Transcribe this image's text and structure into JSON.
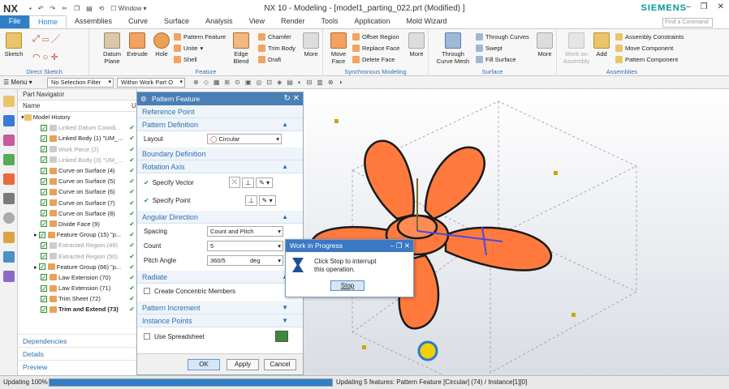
{
  "app": {
    "logo": "NX",
    "title": "NX 10 - Modeling - [model1_parting_022.prt  (Modified)  ]",
    "brand": "SIEMENS",
    "window_menu": "Window"
  },
  "tabs": [
    "File",
    "Home",
    "Assemblies",
    "Curve",
    "Surface",
    "Analysis",
    "View",
    "Render",
    "Tools",
    "Application",
    "Mold Wizard"
  ],
  "search": {
    "placeholder": "Find a Command"
  },
  "ribbon": {
    "direct_sketch": {
      "label": "Direct Sketch",
      "sketch": "Sketch"
    },
    "feature": {
      "label": "Feature",
      "datum": "Datum Plane",
      "extrude": "Extrude",
      "hole": "Hole",
      "pattern_feature": "Pattern Feature",
      "unite": "Unite",
      "shell": "Shell",
      "edge_blend": "Edge Blend",
      "chamfer": "Chamfer",
      "trim_body": "Trim Body",
      "draft": "Draft",
      "more": "More"
    },
    "sync": {
      "label": "Synchronous Modeling",
      "move_face": "Move Face",
      "offset_region": "Offset Region",
      "replace_face": "Replace Face",
      "delete_face": "Delete Face",
      "more": "More"
    },
    "surface": {
      "label": "Surface",
      "through_curve_mesh": "Through Curve Mesh",
      "through_curves": "Through Curves",
      "swept": "Swept",
      "fill_surface": "Fill Surface",
      "more": "More"
    },
    "assemblies": {
      "label": "Assemblies",
      "work_on_assembly": "Work on Assembly",
      "add": "Add",
      "assembly_constraints": "Assembly Constraints",
      "move_component": "Move Component",
      "pattern_component": "Pattern Component"
    }
  },
  "toolbar": {
    "menu": "Menu",
    "filter": "No Selection Filter",
    "scope": "Within Work Part O"
  },
  "navigator": {
    "title": "Part Navigator",
    "col_name": "Name",
    "col_u": "U",
    "root": "Model History",
    "items": [
      {
        "label": "Linked Datum Coordi...",
        "style": "gray"
      },
      {
        "label": "Linked Body (1) \"UM_...",
        "style": "normal"
      },
      {
        "label": "Work Piece (2)",
        "style": "gray"
      },
      {
        "label": "Linked Body (3) \"UM_...",
        "style": "gray"
      },
      {
        "label": "Curve on Surface (4)",
        "style": "normal"
      },
      {
        "label": "Curve on Surface (5)",
        "style": "normal"
      },
      {
        "label": "Curve on Surface (6)",
        "style": "normal"
      },
      {
        "label": "Curve on Surface (7)",
        "style": "normal"
      },
      {
        "label": "Curve on Surface (8)",
        "style": "normal"
      },
      {
        "label": "Divide Face (9)",
        "style": "normal"
      },
      {
        "label": "Feature Group (15) \"p...",
        "style": "normal"
      },
      {
        "label": "Extracted Region (49)",
        "style": "gray"
      },
      {
        "label": "Extracted Region (50)",
        "style": "gray"
      },
      {
        "label": "Feature Group (66) \"p...",
        "style": "normal"
      },
      {
        "label": "Law Extension (70)",
        "style": "normal"
      },
      {
        "label": "Law Extension (71)",
        "style": "normal"
      },
      {
        "label": "Trim Sheet (72)",
        "style": "normal"
      },
      {
        "label": "Trim and Extend (73)",
        "style": "bold"
      }
    ],
    "links": [
      "Dependencies",
      "Details",
      "Preview"
    ]
  },
  "dialog": {
    "title": "Pattern Feature",
    "reference_point": "Reference Point",
    "pattern_definition": "Pattern Definition",
    "layout_label": "Layout",
    "layout_value": "Circular",
    "boundary_definition": "Boundary Definition",
    "rotation_axis": "Rotation Axis",
    "specify_vector": "Specify Vector",
    "specify_point": "Specify Point",
    "angular_direction": "Angular Direction",
    "spacing_label": "Spacing",
    "spacing_value": "Count and Pitch",
    "count_label": "Count",
    "count_value": "5",
    "pitch_label": "Pitch Angle",
    "pitch_value": "360/5",
    "pitch_unit": "deg",
    "radiate": "Radiate",
    "create_concentric": "Create Concentric Members",
    "pattern_increment": "Pattern Increment",
    "instance_points": "Instance Points",
    "use_spreadsheet": "Use Spreadsheet",
    "ok": "OK",
    "apply": "Apply",
    "cancel": "Cancel"
  },
  "wip": {
    "title": "Work in Progress",
    "message_1": "Click Stop to interrupt",
    "message_2": "this operation.",
    "stop": "Stop"
  },
  "status": {
    "left": "Updating 100%",
    "progress": 1.0,
    "right": "Updating 5 features: Pattern Feature [Circular] (74) / Instance[1][0]"
  },
  "colors": {
    "accent": "#2f7fc8",
    "brand": "#009999",
    "part": "#ff7a3c"
  }
}
